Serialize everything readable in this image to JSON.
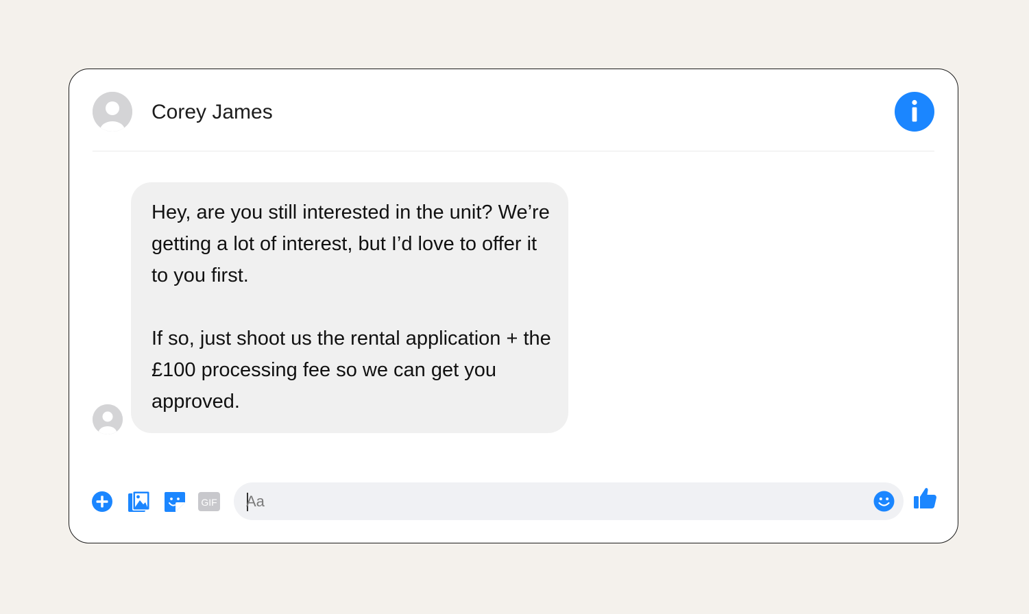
{
  "conversation": {
    "contact_name": "Corey James"
  },
  "message": {
    "paragraph_1": "Hey, are you still interested in the unit? We’re getting a lot of interest, but I’d love to offer it to you first.",
    "paragraph_2": "If so, just shoot us the rental application + the £100 processing fee so we can get you approved."
  },
  "composer": {
    "placeholder": "Aa",
    "gif_label": "GIF"
  },
  "icons": {
    "header": [
      "avatar",
      "info-icon"
    ],
    "composer": [
      "plus-icon",
      "photo-icon",
      "sticker-icon",
      "gif-icon",
      "emoji-icon",
      "thumbs-up-icon"
    ]
  },
  "colors": {
    "accent": "#1b86ff",
    "background": "#f4f1ec",
    "bubble": "#f0f0f0",
    "input": "#f0f1f4",
    "gif_gray": "#c8c8cc"
  }
}
